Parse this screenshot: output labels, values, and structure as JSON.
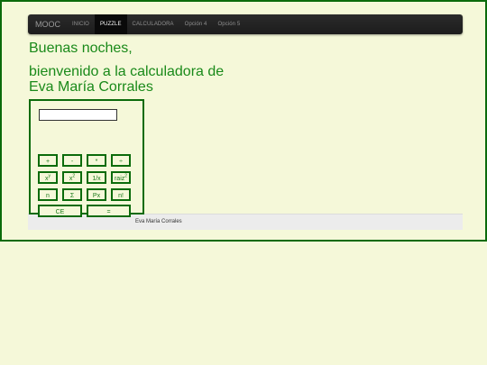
{
  "nav": {
    "brand": "MOOC",
    "items": [
      "INICIO",
      "PUZZLE",
      "CALCULADORA",
      "Opción 4",
      "Opción 5"
    ]
  },
  "greeting": {
    "line1": "Buenas noches,",
    "line2": "bienvenido a la calculadora de",
    "line3": "Eva María Corrales"
  },
  "calculator": {
    "display_value": "",
    "keys": {
      "plus": "+",
      "minus": "-",
      "multiply": "*",
      "divide": "÷",
      "power_base": "x",
      "power_exp": "y",
      "square_base": "x",
      "square_exp": "2",
      "reciprocal": "1/x",
      "sqrt_base": "raiz",
      "sqrt_exp": "2",
      "n": "n",
      "sum": "Σ",
      "px": "Px",
      "factorial": "n!",
      "clear": "CE",
      "equals": "="
    }
  },
  "footer": {
    "text": "Eva María Corrales"
  },
  "colors": {
    "accent": "#1a8a1a",
    "border": "#0b6b0b",
    "background": "#f5f8d9",
    "navbar": "#222222"
  }
}
